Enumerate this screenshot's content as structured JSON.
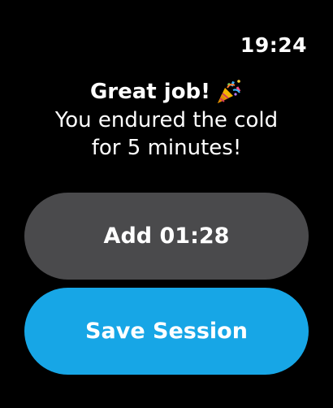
{
  "status": {
    "time": "19:24"
  },
  "message": {
    "headline": "Great job!",
    "headline_icon": "party-popper-icon",
    "line1": "You endured the cold",
    "line2": "for 5 minutes!"
  },
  "buttons": {
    "add_label": "Add 01:28",
    "save_label": "Save Session"
  },
  "colors": {
    "background": "#000000",
    "add_button": "#4a4a4c",
    "save_button": "#17a6e6",
    "text": "#ffffff"
  }
}
